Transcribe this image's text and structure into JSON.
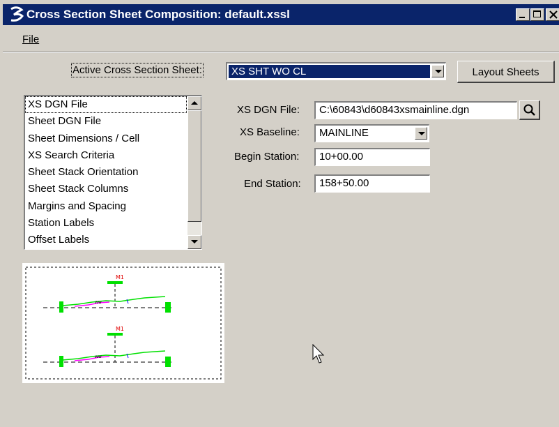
{
  "window": {
    "title": "Cross Section Sheet Composition: default.xssl",
    "controls": [
      "minimize-icon",
      "maximize-icon",
      "close-icon"
    ]
  },
  "menu": {
    "file_label": "File"
  },
  "header": {
    "active_sheet_label": "Active Cross Section Sheet:",
    "active_sheet_value": "XS SHT WO CL",
    "layout_button_label": "Layout Sheets"
  },
  "settings_list": {
    "items": [
      {
        "label": "XS DGN File"
      },
      {
        "label": "Sheet DGN File"
      },
      {
        "label": "Sheet Dimensions / Cell"
      },
      {
        "label": "XS Search Criteria"
      },
      {
        "label": "Sheet Stack Orientation"
      },
      {
        "label": "Sheet Stack Columns"
      },
      {
        "label": "Margins and Spacing"
      },
      {
        "label": "Station Labels"
      },
      {
        "label": "Offset Labels"
      }
    ]
  },
  "form": {
    "xs_dgn_label": "XS DGN File:",
    "xs_dgn_value": "C:\\60843\\d60843xsmainline.dgn",
    "baseline_label": "XS Baseline:",
    "baseline_value": "MAINLINE",
    "begin_label": "Begin Station:",
    "begin_value": "10+00.00",
    "end_label": "End Station:",
    "end_value": "158+50.00"
  },
  "preview": {
    "sections": [
      {
        "label": "M1"
      },
      {
        "label": "M1"
      }
    ]
  },
  "colors": {
    "titlebar": "#0a246a",
    "dialog_face": "#d4d0c8",
    "selection": "#0a246a",
    "preview_green": "#00e000",
    "preview_label_red": "#e00000"
  }
}
